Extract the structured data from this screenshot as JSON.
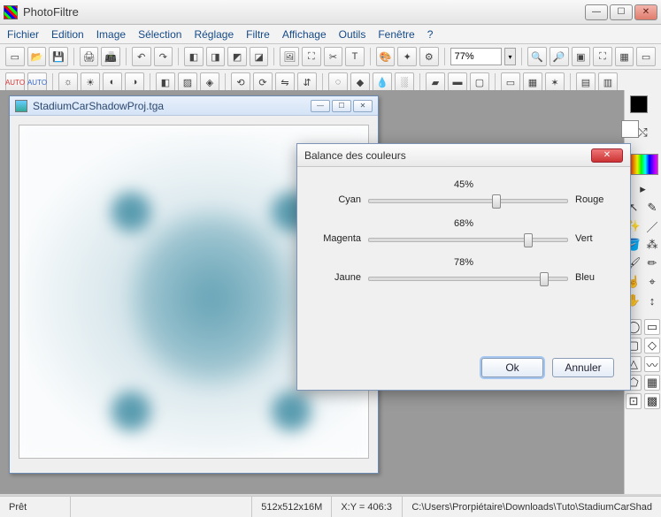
{
  "app": {
    "title": "PhotoFiltre"
  },
  "menu": [
    "Fichier",
    "Edition",
    "Image",
    "Sélection",
    "Réglage",
    "Filtre",
    "Affichage",
    "Outils",
    "Fenêtre",
    "?"
  ],
  "zoom": {
    "value": "77%"
  },
  "document": {
    "title": "StadiumCarShadowProj.tga"
  },
  "dialog": {
    "title": "Balance des couleurs",
    "sliders": [
      {
        "left": "Cyan",
        "right": "Rouge",
        "percent": "45%",
        "pos": 62
      },
      {
        "left": "Magenta",
        "right": "Vert",
        "percent": "68%",
        "pos": 78
      },
      {
        "left": "Jaune",
        "right": "Bleu",
        "percent": "78%",
        "pos": 86
      }
    ],
    "ok": "Ok",
    "cancel": "Annuler"
  },
  "status": {
    "ready": "Prêt",
    "dims": "512x512x16M",
    "coords": "X:Y = 406:3",
    "path": "C:\\Users\\Prorpiétaire\\Downloads\\Tuto\\StadiumCarShad"
  }
}
